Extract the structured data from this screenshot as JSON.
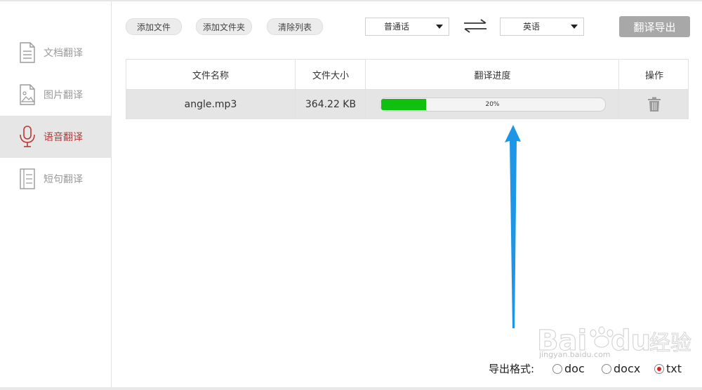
{
  "sidebar": {
    "items": [
      {
        "label": "文档翻译",
        "icon": "document-icon",
        "active": false
      },
      {
        "label": "图片翻译",
        "icon": "image-icon",
        "active": false
      },
      {
        "label": "语音翻译",
        "icon": "microphone-icon",
        "active": true
      },
      {
        "label": "短句翻译",
        "icon": "sentence-icon",
        "active": false
      }
    ]
  },
  "toolbar": {
    "add_file": "添加文件",
    "add_folder": "添加文件夹",
    "clear_list": "清除列表",
    "source_lang": "普通话",
    "target_lang": "英语",
    "swap_icon": "swap-arrows-icon",
    "export_label": "翻译导出"
  },
  "table": {
    "headers": [
      "文件名称",
      "文件大小",
      "翻译进度",
      "操作"
    ],
    "rows": [
      {
        "name": "angle.mp3",
        "size": "364.22 KB",
        "progress": 0.2,
        "progress_label": "20%",
        "action_icon": "trash-icon"
      }
    ]
  },
  "export_format": {
    "label": "导出格式:",
    "options": [
      {
        "label": "doc",
        "checked": false
      },
      {
        "label": "docx",
        "checked": false
      },
      {
        "label": "txt",
        "checked": true
      }
    ]
  },
  "watermark": {
    "brand": "Bai du 经验",
    "url": "jingyan.baidu.com"
  },
  "colors": {
    "accent_active": "#b63a3a",
    "progress_fill": "#10c010",
    "export_button": "#a8a8a8",
    "annotation_arrow": "#1e96e8",
    "radio_checked": "#e02020"
  }
}
